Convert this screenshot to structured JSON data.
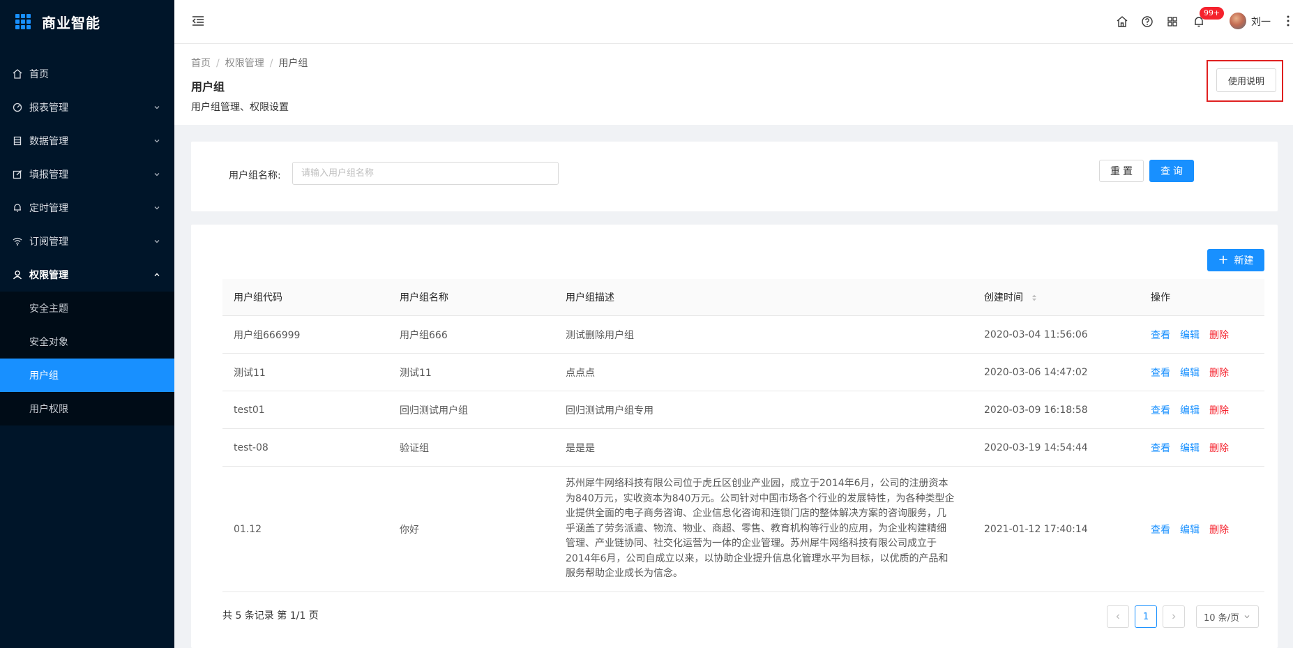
{
  "brand": {
    "title": "商业智能"
  },
  "sidebar": {
    "items": [
      {
        "label": "首页",
        "icon": "home-icon"
      },
      {
        "label": "报表管理",
        "icon": "dashboard-icon"
      },
      {
        "label": "数据管理",
        "icon": "database-icon"
      },
      {
        "label": "填报管理",
        "icon": "edit-icon"
      },
      {
        "label": "定时管理",
        "icon": "bell-icon"
      },
      {
        "label": "订阅管理",
        "icon": "wifi-icon"
      },
      {
        "label": "权限管理",
        "icon": "user-icon"
      }
    ],
    "submenu": [
      {
        "label": "安全主题"
      },
      {
        "label": "安全对象"
      },
      {
        "label": "用户组"
      },
      {
        "label": "用户权限"
      }
    ]
  },
  "header": {
    "badge": "99+",
    "username": "刘一"
  },
  "page": {
    "breadcrumb": [
      "首页",
      "权限管理",
      "用户组"
    ],
    "title": "用户组",
    "description": "用户组管理、权限设置",
    "help_button": "使用说明"
  },
  "search": {
    "label": "用户组名称:",
    "placeholder": "请输入用户组名称",
    "value": "",
    "reset_label": "重置",
    "query_label": "查询"
  },
  "table": {
    "new_button": "新建",
    "columns": [
      "用户组代码",
      "用户组名称",
      "用户组描述",
      "创建时间",
      "操作"
    ],
    "actions": {
      "view": "查看",
      "edit": "编辑",
      "delete": "删除"
    },
    "rows": [
      {
        "code": "用户组666999",
        "name": "用户组666",
        "desc": "测试删除用户组",
        "time": "2020-03-04 11:56:06"
      },
      {
        "code": "测试11",
        "name": "测试11",
        "desc": "点点点",
        "time": "2020-03-06 14:47:02"
      },
      {
        "code": "test01",
        "name": "回归测试用户组",
        "desc": "回归测试用户组专用",
        "time": "2020-03-09 16:18:58"
      },
      {
        "code": "test-08",
        "name": "验证组",
        "desc": "是是是",
        "time": "2020-03-19 14:54:44"
      },
      {
        "code": "01.12",
        "name": "你好",
        "desc": "苏州犀牛网络科技有限公司位于虎丘区创业产业园，成立于2014年6月，公司的注册资本为840万元，实收资本为840万元。公司针对中国市场各个行业的发展特性，为各种类型企业提供全面的电子商务咨询、企业信息化咨询和连锁门店的整体解决方案的咨询服务，几乎涵盖了劳务派遣、物流、物业、商超、零售、教育机构等行业的应用，为企业构建精细管理、产业链协同、社交化运营为一体的企业管理。苏州犀牛网络科技有限公司成立于2014年6月，公司自成立以来，以协助企业提升信息化管理水平为目标，以优质的产品和服务帮助企业成长为信念。",
        "time": "2021-01-12 17:40:14"
      }
    ]
  },
  "pagination": {
    "total_text": "共 5 条记录 第 1/1 页",
    "current_page": "1",
    "page_size": "10 条/页"
  },
  "colors": {
    "primary": "#1890ff",
    "danger": "#f5222d",
    "sidebar_bg": "#001529"
  }
}
